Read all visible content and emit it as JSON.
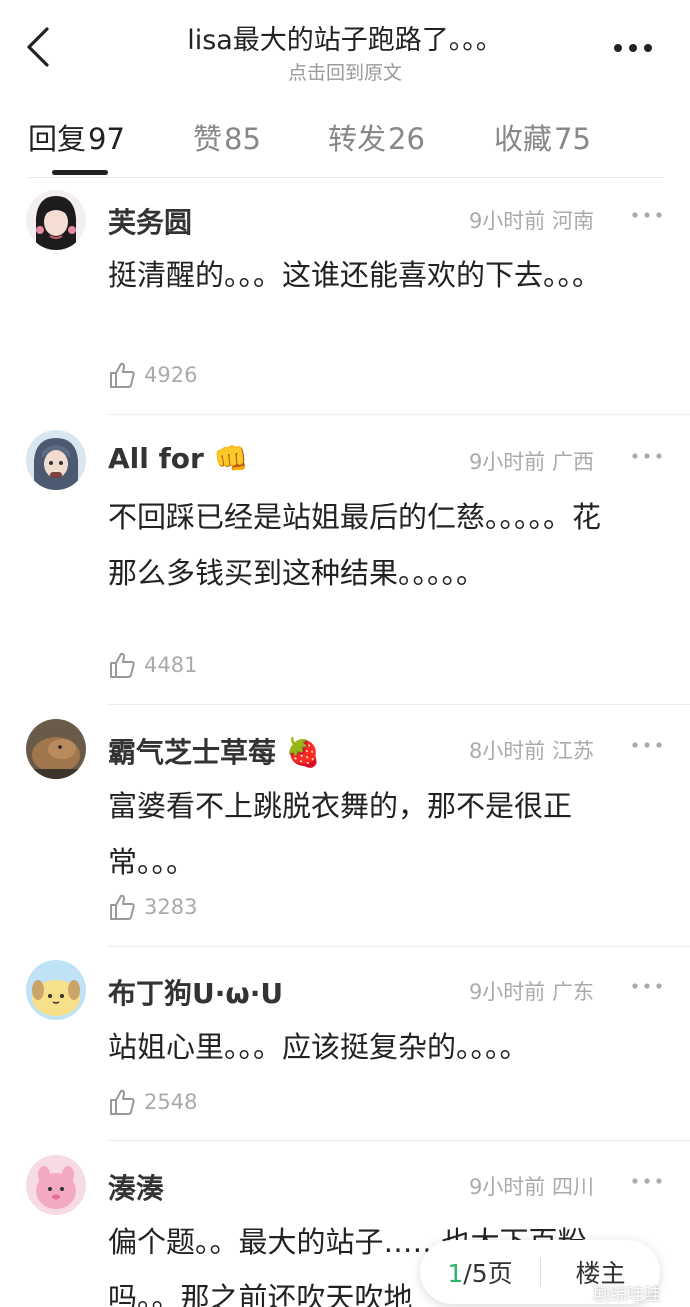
{
  "header": {
    "title": "lisa最大的站子跑路了。。。",
    "subtitle": "点击回到原文"
  },
  "tabs": [
    {
      "label": "回复",
      "count": "97",
      "active": true
    },
    {
      "label": "赞",
      "count": "85",
      "active": false
    },
    {
      "label": "转发",
      "count": "26",
      "active": false
    },
    {
      "label": "收藏",
      "count": "75",
      "active": false
    }
  ],
  "comments": [
    {
      "name": "芙务圆",
      "time": "9小时前",
      "location": "河南",
      "text": "挺清醒的。。。这谁还能喜欢的下去。。。",
      "likes": "4926"
    },
    {
      "name": "All for",
      "emoji": "👊",
      "time": "9小时前",
      "location": "广西",
      "text": "不回踩已经是站姐最后的仁慈。。。。。花那么多钱买到这种结果。。。。。",
      "likes": "4481"
    },
    {
      "name": "霸气芝士草莓",
      "emoji": "🍓",
      "time": "8小时前",
      "location": "江苏",
      "text": "富婆看不上跳脱衣舞的，那不是很正常。。。",
      "likes": "3283"
    },
    {
      "name": "布丁狗U·ω·U",
      "time": "9小时前",
      "location": "广东",
      "text": "站姐心里。。。应该挺复杂的。。。。",
      "likes": "2548"
    },
    {
      "name": "湊湊",
      "time": "9小时前",
      "location": "四川",
      "text": "偏个题。。最大的站子……也太下百粉吗。。那之前还吹天吹地",
      "likes": ""
    }
  ],
  "pager": {
    "current": "1",
    "rest": "/5页",
    "owner_label": "楼主"
  },
  "watermark": "剧综哇哇",
  "colors": {
    "accent_green": "#2db36a",
    "muted_text": "#aaaaaa",
    "primary_text": "#222222"
  },
  "icons": [
    "back-arrow-icon",
    "more-dots-icon",
    "thumb-up-icon",
    "weibo-icon"
  ]
}
